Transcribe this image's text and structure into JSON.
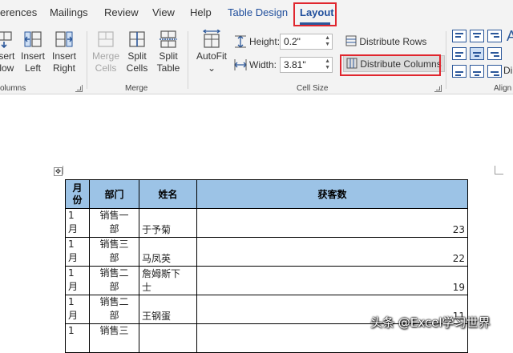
{
  "tabs": [
    {
      "label": "erences"
    },
    {
      "label": "Mailings"
    },
    {
      "label": "Review"
    },
    {
      "label": "View"
    },
    {
      "label": "Help"
    },
    {
      "label": "Table Design"
    },
    {
      "label": "Layout"
    }
  ],
  "ribbon": {
    "rows_columns": {
      "insert_below": {
        "line1": "nsert",
        "line2": "elow"
      },
      "insert_left": {
        "line1": "Insert",
        "line2": "Left"
      },
      "insert_right": {
        "line1": "Insert",
        "line2": "Right"
      },
      "group_label": "olumns"
    },
    "merge": {
      "merge_cells": {
        "line1": "Merge",
        "line2": "Cells"
      },
      "split_cells": {
        "line1": "Split",
        "line2": "Cells"
      },
      "split_table": {
        "line1": "Split",
        "line2": "Table"
      },
      "group_label": "Merge"
    },
    "cell_size": {
      "autofit": {
        "label": "AutoFit",
        "chevron": "⌄"
      },
      "height_label": "Height:",
      "height_value": "0.2\"",
      "width_label": "Width:",
      "width_value": "3.81\"",
      "distribute_rows": "Distribute Rows",
      "distribute_columns": "Distribute Columns",
      "group_label": "Cell Size"
    },
    "alignment": {
      "group_label": "Align",
      "direction_label": "Dir",
      "letter": "A"
    }
  },
  "table": {
    "headers": [
      "月份",
      "部门",
      "姓名",
      "获客数"
    ],
    "header_month_lines": [
      "月",
      "份"
    ],
    "rows": [
      {
        "month": [
          "1",
          "月"
        ],
        "dept": [
          "销售一",
          "部"
        ],
        "name": [
          "",
          "于予菊"
        ],
        "count": "23"
      },
      {
        "month": [
          "1",
          "月"
        ],
        "dept": [
          "销售三",
          "部"
        ],
        "name": [
          "",
          "马凤英"
        ],
        "count": "22"
      },
      {
        "month": [
          "1",
          "月"
        ],
        "dept": [
          "销售二",
          "部"
        ],
        "name": [
          "詹姆斯下",
          "士"
        ],
        "count": "19"
      },
      {
        "month": [
          "1",
          "月"
        ],
        "dept": [
          "销售二",
          "部"
        ],
        "name": [
          "",
          "王钢蛋"
        ],
        "count": "11"
      },
      {
        "month": [
          "1",
          ""
        ],
        "dept": [
          "销售三",
          ""
        ],
        "name": [
          "",
          ""
        ],
        "count": ""
      }
    ]
  },
  "watermark": "头条 @Excel学习世界",
  "colors": {
    "accent": "#2b579a",
    "highlight": "#e0262e",
    "header_fill": "#9cc3e6"
  }
}
